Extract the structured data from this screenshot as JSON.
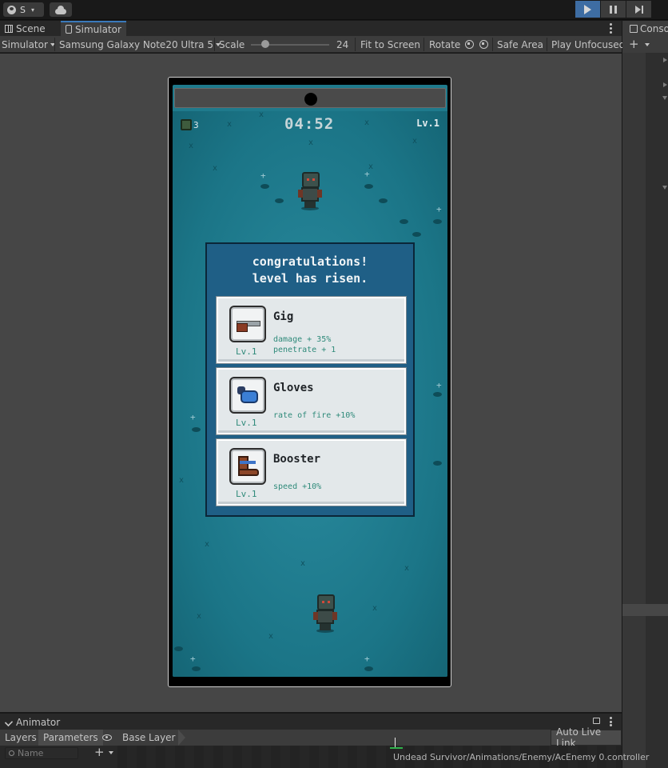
{
  "topbar": {
    "account_letter": "S"
  },
  "tabs": [
    {
      "label": "Scene",
      "active": false
    },
    {
      "label": "Simulator",
      "active": true
    }
  ],
  "simulator_toolbar": {
    "mode": "Simulator",
    "device": "Samsung Galaxy Note20 Ultra 5",
    "scale_label": "Scale",
    "scale_value": "24",
    "fit_to_screen": "Fit to Screen",
    "rotate": "Rotate",
    "safe_area": "Safe Area",
    "play_mode": "Play Unfocused"
  },
  "console": {
    "title": "Conso"
  },
  "game": {
    "kill_count": "3",
    "timer": "04:52",
    "level": "Lv.1",
    "levelup": {
      "title_line1": "congratulations!",
      "title_line2": "level has risen.",
      "cards": [
        {
          "name": "Gig",
          "level": "Lv.1",
          "desc1": "damage + 35%",
          "desc2": "penetrate + 1",
          "icon": "gig-icon"
        },
        {
          "name": "Gloves",
          "level": "Lv.1",
          "desc1": "rate of fire +10%",
          "icon": "gloves-icon"
        },
        {
          "name": "Booster",
          "level": "Lv.1",
          "desc1": "speed +10%",
          "icon": "booster-icon"
        }
      ]
    }
  },
  "animator": {
    "title": "Animator",
    "layers_tab": "Layers",
    "parameters_tab": "Parameters",
    "breadcrumb": "Base Layer",
    "auto_live_link": "Auto Live Link",
    "search_placeholder": "Name",
    "controller_path": "Undead Survivor/Animations/Enemy/AcEnemy 0.controller"
  },
  "colors": {
    "play_active": "#3e6da3",
    "game_water": "#1f7a8c",
    "panel_blue": "#1f5f86",
    "stat_text": "#2f8a7a"
  }
}
